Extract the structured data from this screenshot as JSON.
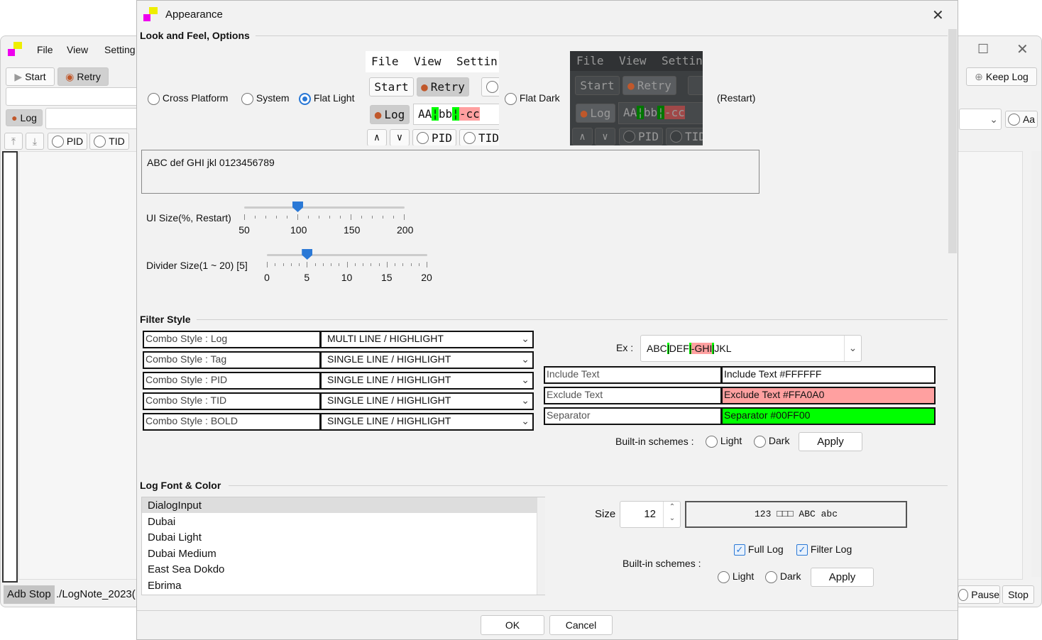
{
  "main_window": {
    "menu": [
      "File",
      "View",
      "Setting"
    ],
    "start": "Start",
    "retry": "Retry",
    "keep_log": "Keep Log",
    "log": "Log",
    "pid": "PID",
    "tid": "TID",
    "aa": "Aa",
    "status_adb": "Adb Stop",
    "status_path": "./LogNote_2023(",
    "pause": "Pause",
    "stop": "Stop"
  },
  "dialog": {
    "title": "Appearance",
    "laf": {
      "heading": "Look and Feel, Options",
      "options": [
        {
          "label": "Cross Platform",
          "selected": false
        },
        {
          "label": "System",
          "selected": false
        },
        {
          "label": "Flat Light",
          "selected": true
        },
        {
          "label": "Flat Dark",
          "selected": false
        }
      ],
      "restart": "(Restart)",
      "preview": {
        "menu": [
          "File",
          "View",
          "Settin"
        ],
        "start": "Start",
        "retry": "Retry",
        "log": "Log",
        "sample": [
          "AA",
          "bb",
          "-cc"
        ],
        "up": "∧",
        "down": "∨",
        "pid": "PID",
        "tid": "TID"
      },
      "sample_text": "ABC def GHI jkl 0123456789",
      "ui_size": {
        "label": "UI Size(%, Restart)",
        "ticks": [
          "50",
          "100",
          "150",
          "200"
        ],
        "value": 100
      },
      "divider": {
        "label": "Divider Size(1 ~ 20) [5]",
        "ticks": [
          "0",
          "5",
          "10",
          "15",
          "20"
        ],
        "value": 5
      }
    },
    "filter": {
      "heading": "Filter Style",
      "rows": [
        {
          "label": "Combo Style : Log",
          "value": "MULTI LINE / HIGHLIGHT"
        },
        {
          "label": "Combo Style : Tag",
          "value": "SINGLE LINE / HIGHLIGHT"
        },
        {
          "label": "Combo Style : PID",
          "value": "SINGLE LINE / HIGHLIGHT"
        },
        {
          "label": "Combo Style : TID",
          "value": "SINGLE LINE / HIGHLIGHT"
        },
        {
          "label": "Combo Style : BOLD",
          "value": "SINGLE LINE / HIGHLIGHT"
        }
      ],
      "ex_label": "Ex :",
      "ex_parts": [
        "ABC",
        "DEF",
        "-GHI",
        "JKL"
      ],
      "colors": [
        {
          "label": "Include Text",
          "value": "Include Text #FFFFFF",
          "color": "#FFFFFF"
        },
        {
          "label": "Exclude Text",
          "value": "Exclude Text #FFA0A0",
          "color": "#FFA0A0"
        },
        {
          "label": "Separator",
          "value": "Separator #00FF00",
          "color": "#00FF00"
        }
      ],
      "schemes_label": "Built-in schemes :",
      "light": "Light",
      "dark": "Dark",
      "apply": "Apply"
    },
    "font": {
      "heading": "Log Font & Color",
      "fonts": [
        "DialogInput",
        "Dubai",
        "Dubai Light",
        "Dubai Medium",
        "East Sea Dokdo",
        "Ebrima"
      ],
      "selected": "DialogInput",
      "size_label": "Size",
      "size": "12",
      "preview": "123 □□□ ABC abc",
      "full_log": "Full Log",
      "filter_log": "Filter Log",
      "schemes_label": "Built-in schemes :",
      "light": "Light",
      "dark": "Dark",
      "apply": "Apply"
    },
    "ok": "OK",
    "cancel": "Cancel"
  }
}
